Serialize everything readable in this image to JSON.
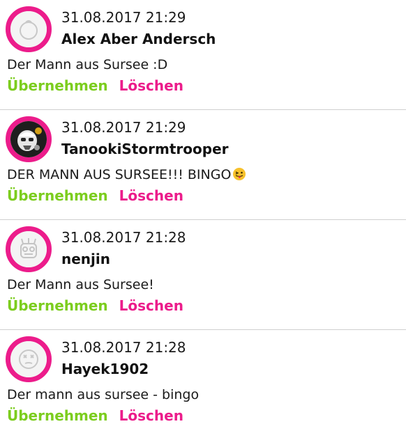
{
  "colors": {
    "accent": "#ec1c8b",
    "accept": "#7ccd1e",
    "divider": "#cfcfcf"
  },
  "comments": [
    {
      "timestamp": "31.08.2017 21:29",
      "username": "Alex Aber Andersch",
      "message": "Der Mann aus Sursee :D",
      "avatar_icon": "default-avatar-icon",
      "accept_label": "Übernehmen",
      "delete_label": "Löschen"
    },
    {
      "timestamp": "31.08.2017 21:29",
      "username": "TanookiStormtrooper",
      "message": "DER MANN AUS SURSEE!!! BINGO",
      "emoji": "tongue-out-emoji",
      "avatar_icon": "stormtrooper-avatar-icon",
      "accept_label": "Übernehmen",
      "delete_label": "Löschen"
    },
    {
      "timestamp": "31.08.2017 21:28",
      "username": "nenjin",
      "message": "Der Mann aus Sursee!",
      "avatar_icon": "robot-avatar-icon",
      "accept_label": "Übernehmen",
      "delete_label": "Löschen"
    },
    {
      "timestamp": "31.08.2017 21:28",
      "username": "Hayek1902",
      "message": "Der mann aus sursee - bingo",
      "avatar_icon": "dizzy-face-avatar-icon",
      "accept_label": "Übernehmen",
      "delete_label": "Löschen"
    }
  ]
}
